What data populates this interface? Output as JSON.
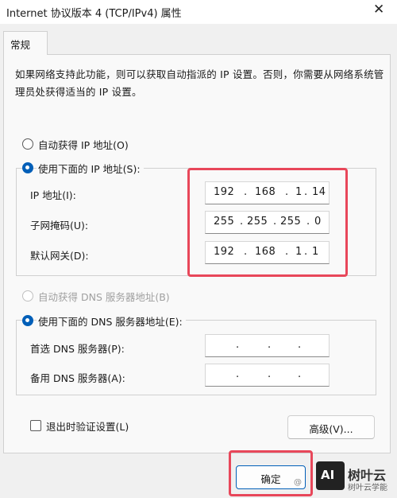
{
  "window": {
    "title": "Internet 协议版本 4 (TCP/IPv4) 属性",
    "close_glyph": "✕"
  },
  "tabs": [
    {
      "label": "常规"
    }
  ],
  "description": "如果网络支持此功能，则可以获取自动指派的 IP 设置。否则，你需要从网络系统管理员处获得适当的 IP 设置。",
  "ip_section": {
    "auto_option": {
      "label": "自动获得 IP 地址(O)",
      "checked": false
    },
    "manual_option": {
      "label": "使用下面的 IP 地址(S):",
      "checked": true
    },
    "fields": [
      {
        "label": "IP 地址(I):",
        "octets": [
          "192",
          "168",
          "1",
          "14"
        ]
      },
      {
        "label": "子网掩码(U):",
        "octets": [
          "255",
          "255",
          "255",
          "0"
        ]
      },
      {
        "label": "默认网关(D):",
        "octets": [
          "192",
          "168",
          "1",
          "1"
        ]
      }
    ]
  },
  "dns_section": {
    "auto_option": {
      "label": "自动获得 DNS 服务器地址(B)",
      "checked": false,
      "disabled": true
    },
    "manual_option": {
      "label": "使用下面的 DNS 服务器地址(E):",
      "checked": true
    },
    "fields": [
      {
        "label": "首选 DNS 服务器(P):",
        "octets": [
          "",
          "",
          "",
          ""
        ]
      },
      {
        "label": "备用 DNS 服务器(A):",
        "octets": [
          "",
          "",
          "",
          ""
        ]
      }
    ]
  },
  "validate_on_exit": {
    "label": "退出时验证设置(L)",
    "checked": false
  },
  "advanced_button": {
    "label": "高级(V)..."
  },
  "ok_button": {
    "label": "确定"
  },
  "watermark": {
    "logo": "AI",
    "text": "树叶云",
    "sub": "树叶云学能",
    "at": "@"
  },
  "highlight_color": "#e8475a",
  "accent_color": "#005fb8"
}
